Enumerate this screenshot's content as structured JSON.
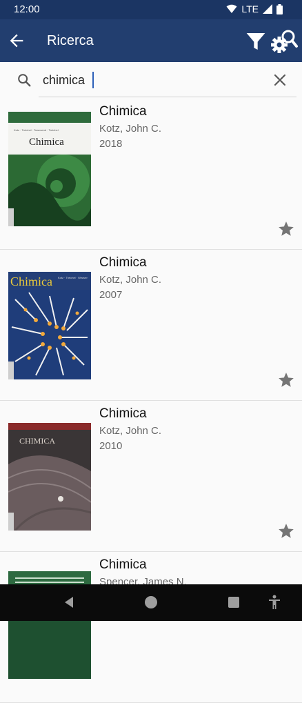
{
  "status": {
    "time": "12:00",
    "network": "LTE"
  },
  "appbar": {
    "title": "Ricerca"
  },
  "search": {
    "value": "chimica"
  },
  "results": [
    {
      "title": "Chimica",
      "author": "Kotz, John C.",
      "year": "2018",
      "cover_title": "Chimica"
    },
    {
      "title": "Chimica",
      "author": "Kotz, John C.",
      "year": "2007",
      "cover_title": "Chimica"
    },
    {
      "title": "Chimica",
      "author": "Kotz, John C.",
      "year": "2010",
      "cover_title": "CHIMICA"
    },
    {
      "title": "Chimica",
      "author": "Spencer, James N."
    }
  ],
  "colors": {
    "appbar": "#223e6f",
    "statusbar": "#1b3563",
    "star": "#757575",
    "background": "#fafafa"
  }
}
